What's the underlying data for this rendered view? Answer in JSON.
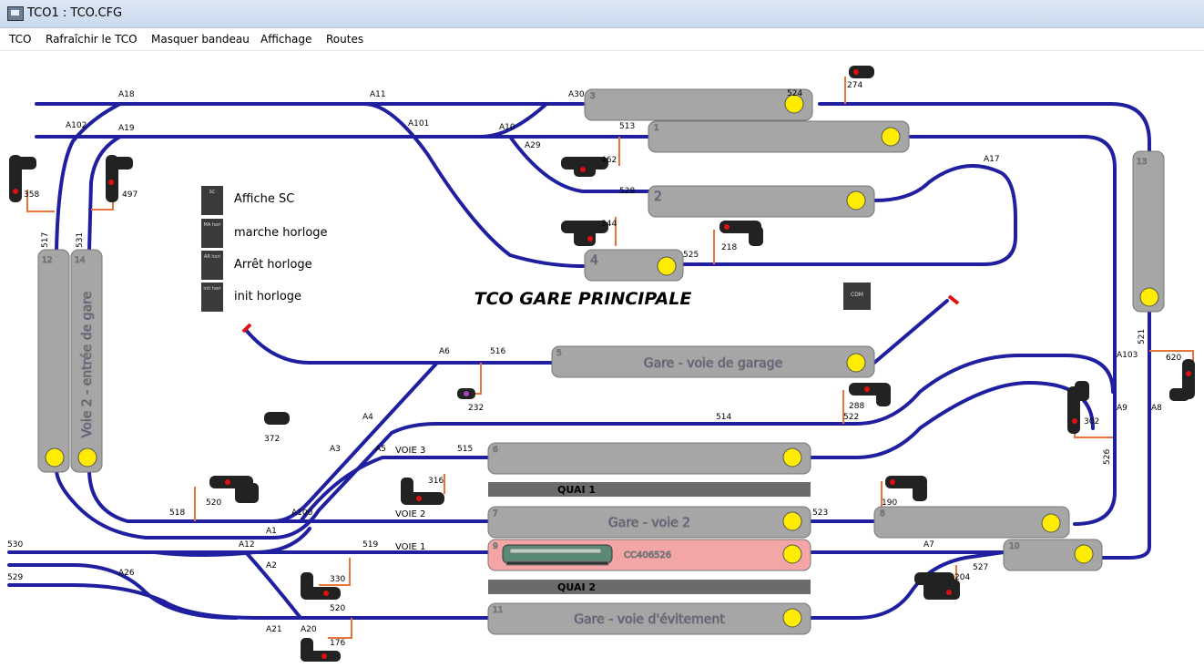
{
  "window": {
    "title": "TCO1 : TCO.CFG"
  },
  "menu": [
    {
      "label": "TCO"
    },
    {
      "label": "Rafraîchir le TCO"
    },
    {
      "label": "Masquer bandeau"
    },
    {
      "label": "Affichage"
    },
    {
      "label": "Routes"
    }
  ],
  "canvas": {
    "heading": "TCO GARE PRINCIPALE",
    "cdm_button": "CDM",
    "buttons": [
      {
        "icon": "SC",
        "label": "Affiche SC"
      },
      {
        "icon": "MA hori",
        "label": "marche horloge"
      },
      {
        "icon": "AR hori",
        "label": "Arrêt horloge"
      },
      {
        "icon": "init hori",
        "label": "init horloge"
      }
    ],
    "blocks": [
      {
        "id": "3",
        "label": ""
      },
      {
        "id": "1",
        "label": ""
      },
      {
        "id": "2",
        "label": "2"
      },
      {
        "id": "4",
        "label": "4"
      },
      {
        "id": "5",
        "label": "Gare - voie de garage"
      },
      {
        "id": "6",
        "label": ""
      },
      {
        "id": "7",
        "label": "Gare - voie 2"
      },
      {
        "id": "9",
        "label": "CC406526"
      },
      {
        "id": "11",
        "label": "Gare - voie d'évitement"
      },
      {
        "id": "8",
        "label": ""
      },
      {
        "id": "10",
        "label": ""
      },
      {
        "id": "12",
        "label": ""
      },
      {
        "id": "14",
        "label": "Voie 2 - entrée de gare"
      },
      {
        "id": "13",
        "label": ""
      }
    ],
    "quais": [
      "QUAI 1",
      "QUAI 2"
    ],
    "voies": [
      "VOIE 3",
      "VOIE 2",
      "VOIE 1"
    ],
    "switches": [
      "A18",
      "A11",
      "A30",
      "A102",
      "A19",
      "A101",
      "A10",
      "A29",
      "A17",
      "A6",
      "A4",
      "A3",
      "A5",
      "A100",
      "A1",
      "A12",
      "A2",
      "A26",
      "A21",
      "A20",
      "A7",
      "A103",
      "A9",
      "A8"
    ],
    "detectors": [
      "524",
      "513",
      "528",
      "525",
      "517",
      "531",
      "516",
      "514",
      "515",
      "522",
      "518",
      "519",
      "523",
      "527",
      "526",
      "521",
      "530",
      "529",
      "520"
    ],
    "signals": [
      "274",
      "462",
      "344",
      "218",
      "358",
      "497",
      "232",
      "288",
      "372",
      "316",
      "520",
      "190",
      "330",
      "204",
      "302",
      "620",
      "176"
    ]
  },
  "colors": {
    "track": "#1f1fa0",
    "block": "#a6a6a6",
    "occupied": "#f4a6a6",
    "lamp": "#ffec00",
    "detector": "#e8743b",
    "signal_red": "#e01010"
  }
}
